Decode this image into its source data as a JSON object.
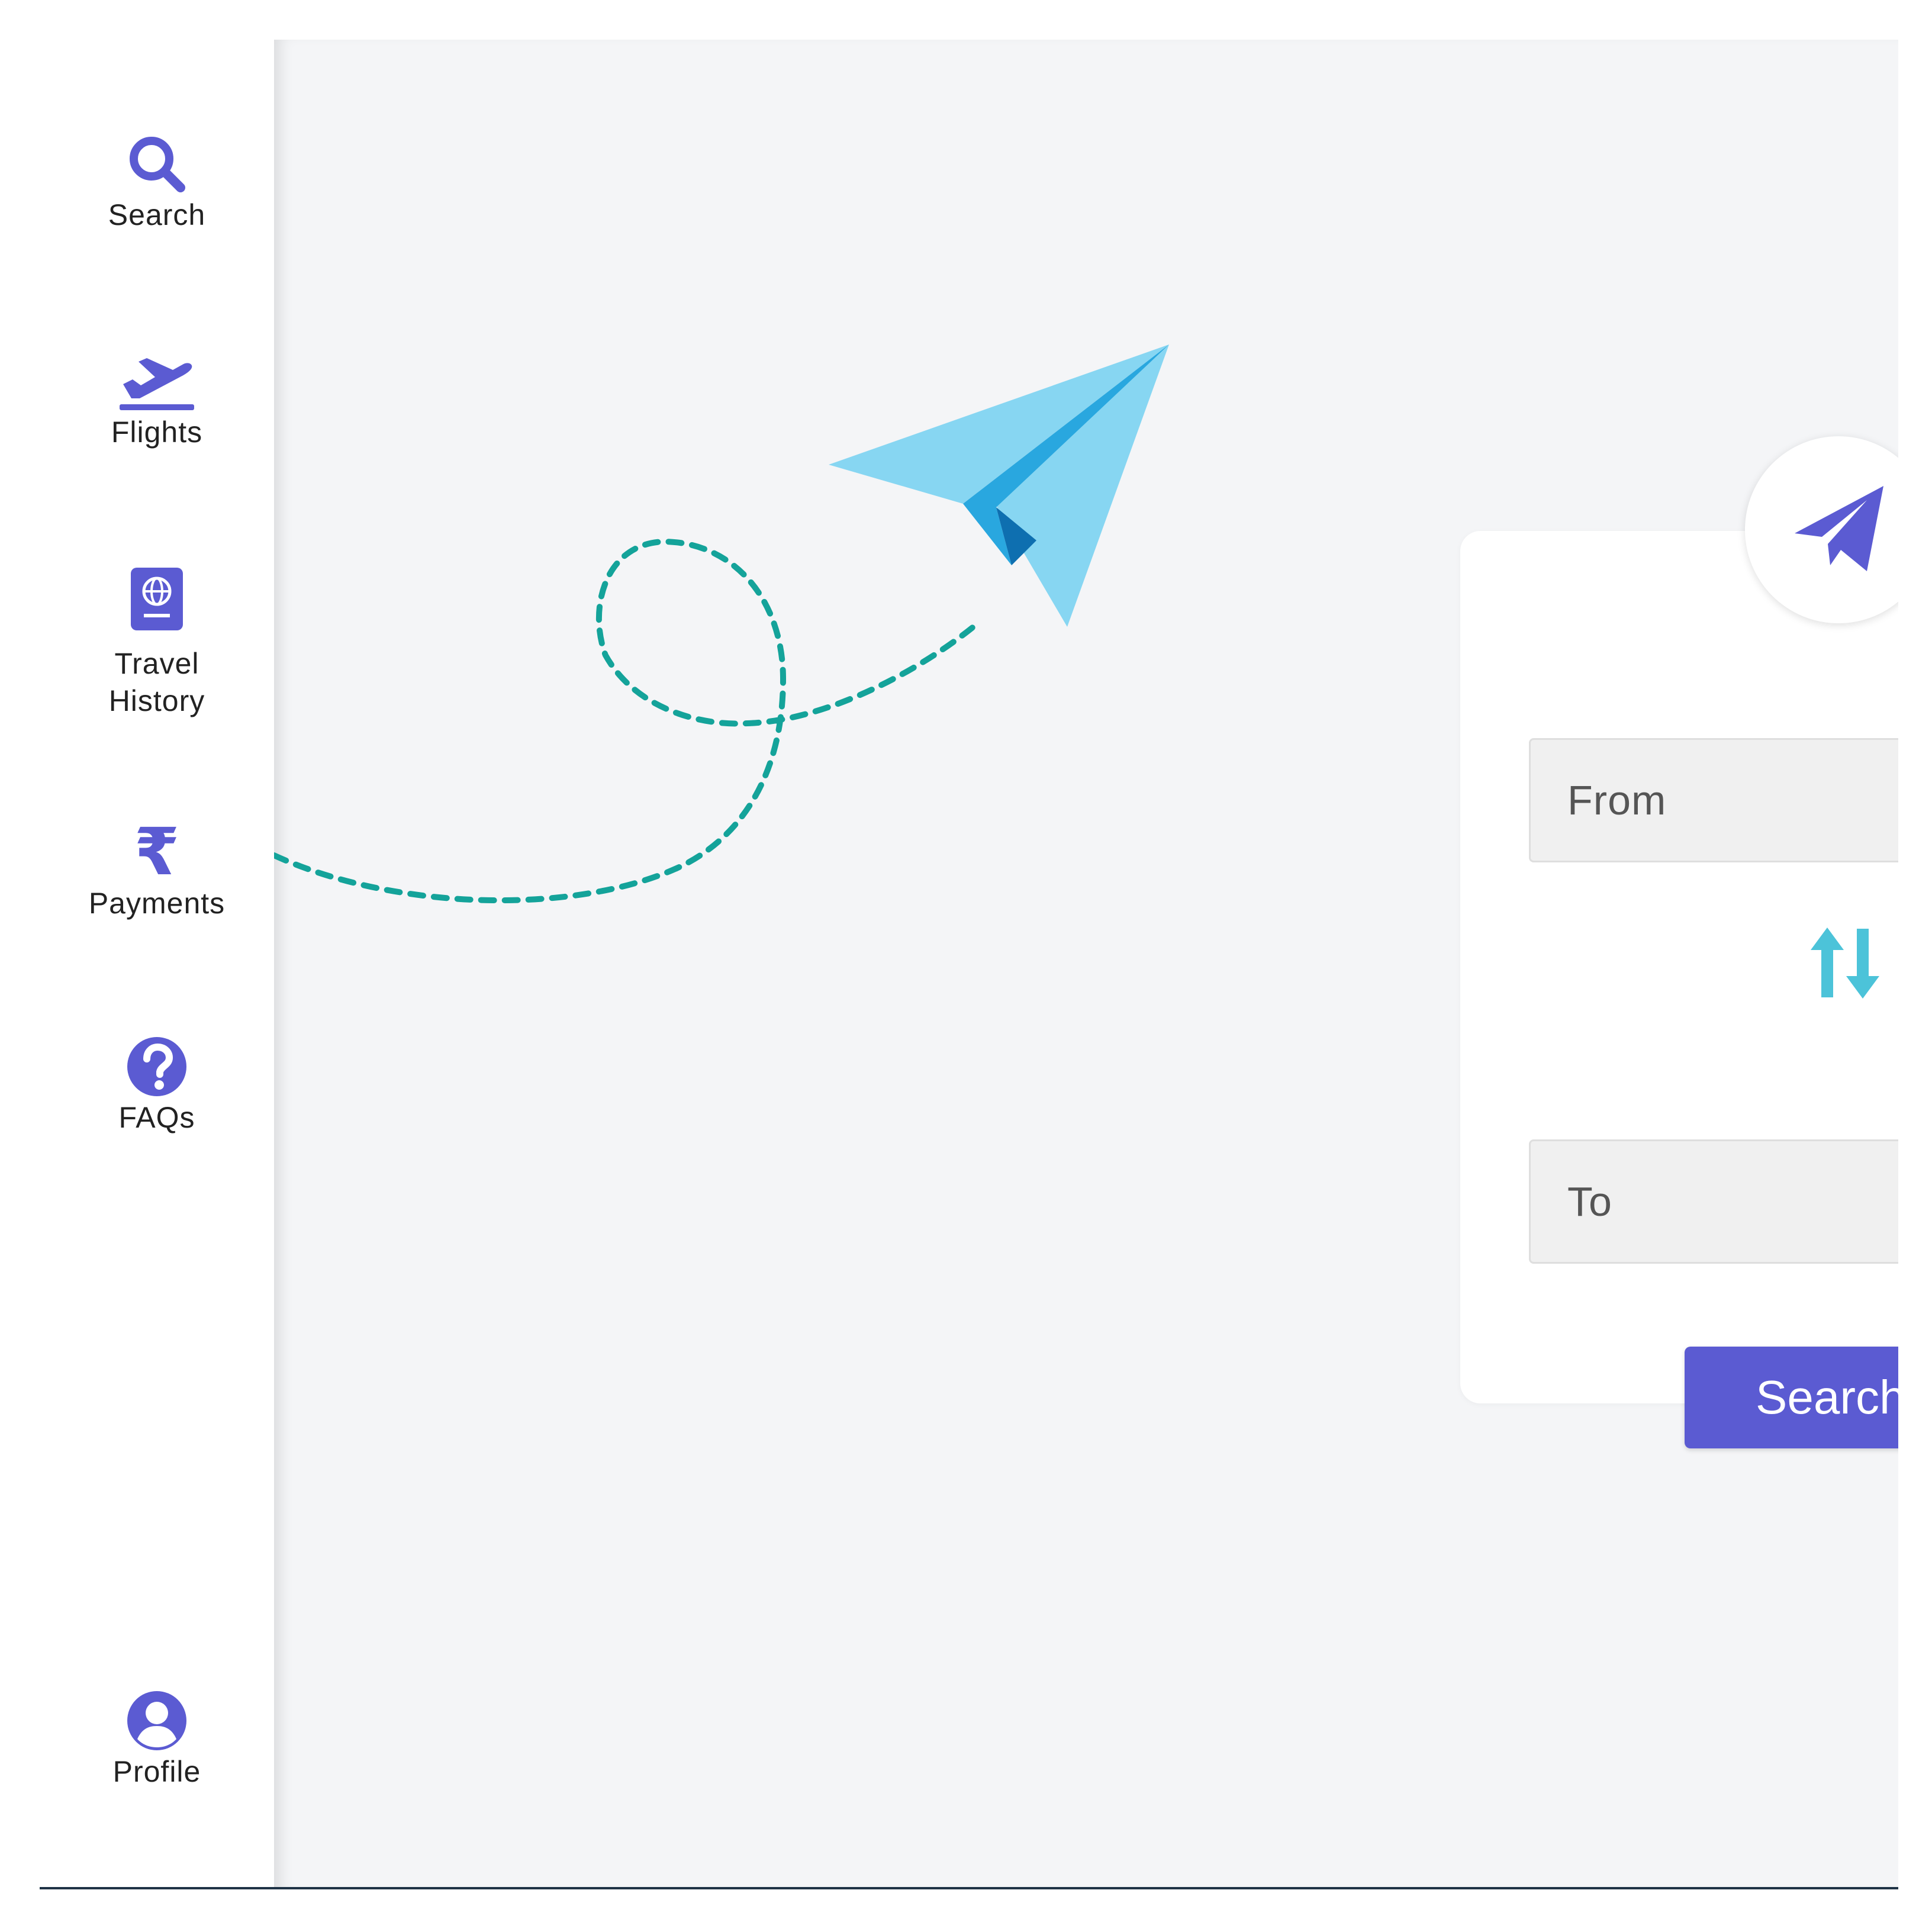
{
  "sidebar": {
    "items": [
      {
        "label": "Search",
        "icon": "search-icon"
      },
      {
        "label": "Flights",
        "icon": "plane-departure-icon"
      },
      {
        "label": "Travel History",
        "icon": "passport-icon"
      },
      {
        "label": "Payments",
        "icon": "rupee-icon"
      },
      {
        "label": "FAQs",
        "icon": "question-circle-icon"
      }
    ],
    "profile": {
      "label": "Profile",
      "icon": "user-circle-icon"
    }
  },
  "form": {
    "from_placeholder": "From",
    "to_placeholder": "To",
    "swap_icon": "swap-vertical-icon",
    "search_label": "Search",
    "badge_icon": "paper-plane-icon"
  },
  "colors": {
    "accent": "#5b5bd2",
    "swap": "#4cc3d9",
    "trail": "#14a39a",
    "plane_light": "#87d6f2",
    "plane_mid": "#29a7df",
    "plane_dark": "#0e6fb0",
    "background": "#f4f5f7"
  }
}
